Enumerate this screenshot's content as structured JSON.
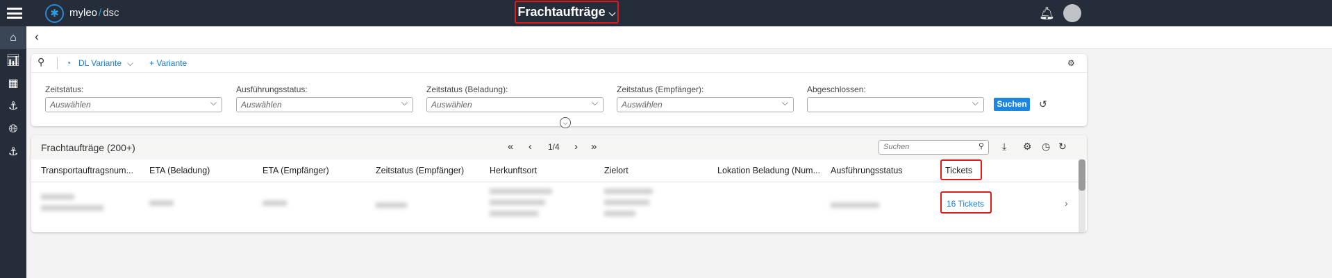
{
  "header": {
    "brand": "myleo",
    "brand_sep": "/",
    "brand_product": "dsc",
    "title": "Frachtaufträge"
  },
  "filter": {
    "variant": "DL Variante",
    "add_variant": "+ Variante",
    "fields": [
      {
        "label": "Zeitstatus:",
        "placeholder": "Auswählen"
      },
      {
        "label": "Ausführungsstatus:",
        "placeholder": "Auswählen"
      },
      {
        "label": "Zeitstatus (Beladung):",
        "placeholder": "Auswählen"
      },
      {
        "label": "Zeitstatus (Empfänger):",
        "placeholder": "Auswählen"
      },
      {
        "label": "Abgeschlossen:",
        "placeholder": ""
      }
    ],
    "search_button": "Suchen"
  },
  "table": {
    "title": "Frachtaufträge (200+)",
    "page": "1/4",
    "search_placeholder": "Suchen",
    "columns": [
      "Transportauftragsnum...",
      "ETA (Beladung)",
      "ETA (Empfänger)",
      "Zeitstatus (Empfänger)",
      "Herkunftsort",
      "Zielort",
      "Lokation Beladung (Num...",
      "Ausführungsstatus",
      "Tickets"
    ],
    "rows": [
      {
        "tickets": "16 Tickets"
      }
    ]
  },
  "colors": {
    "accent": "#1d86e0",
    "highlight": "#e01a1a",
    "topbar": "#242d39"
  }
}
